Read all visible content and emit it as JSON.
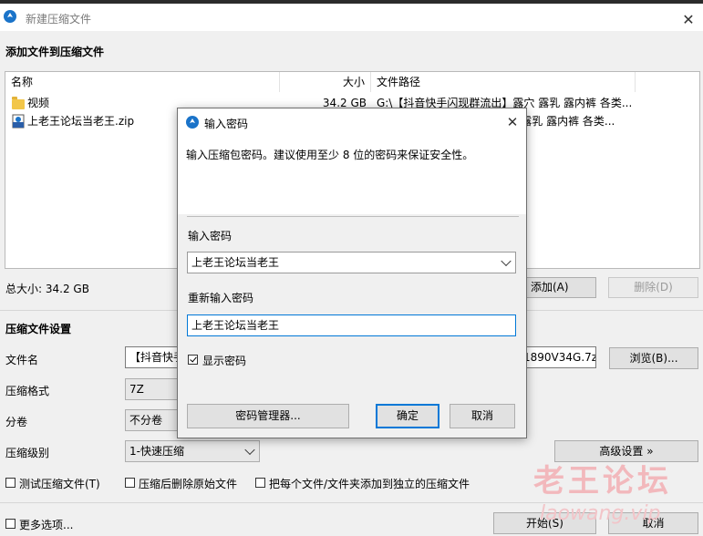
{
  "main_window": {
    "title": "新建压缩文件",
    "section_add": "添加文件到压缩文件",
    "columns": {
      "name": "名称",
      "size": "大小",
      "path": "文件路径"
    },
    "files": [
      {
        "name": "视频",
        "size": "34.2 GB",
        "path": "G:\\【抖音快手闪现群流出】露穴 露乳 露内裤 各类..."
      },
      {
        "name": "上老王论坛当老王.zip",
        "size": "",
        "path": "...穴 露乳 露内裤 各类..."
      }
    ],
    "total_size": "总大小: 34.2 GB",
    "add_button": "添加(A)",
    "delete_button": "删除(D)",
    "section_settings": "压缩文件设置",
    "filename_label": "文件名",
    "filename_value_left": "【抖音快手",
    "filename_value_right": "1890V34G.7z",
    "browse_button": "浏览(B)...",
    "format_label": "压缩格式",
    "format_value": "7Z",
    "split_label": "分卷",
    "split_value": "不分卷",
    "level_label": "压缩级别",
    "level_value": "1-快速压缩",
    "advanced_button": "高级设置 »",
    "test_checkbox": "测试压缩文件(T)",
    "delete_after_checkbox": "压缩后删除原始文件",
    "each_file_checkbox": "把每个文件/文件夹添加到独立的压缩文件",
    "more_options": "更多选项...",
    "start_button": "开始(S)",
    "cancel_button": "取消"
  },
  "dialog": {
    "title": "输入密码",
    "description": "输入压缩包密码。建议使用至少 8 位的密码来保证安全性。",
    "password_label": "输入密码",
    "password_value": "上老王论坛当老王",
    "reenter_label": "重新输入密码",
    "reenter_value": "上老王论坛当老王",
    "show_password": "显示密码",
    "show_password_checked": true,
    "manager_button": "密码管理器...",
    "ok_button": "确定",
    "cancel_button": "取消"
  },
  "watermark": {
    "text": "老王论坛",
    "url": "laowang.vip"
  },
  "colors": {
    "accent": "#0078d7",
    "watermark": "#f2b8bc"
  }
}
